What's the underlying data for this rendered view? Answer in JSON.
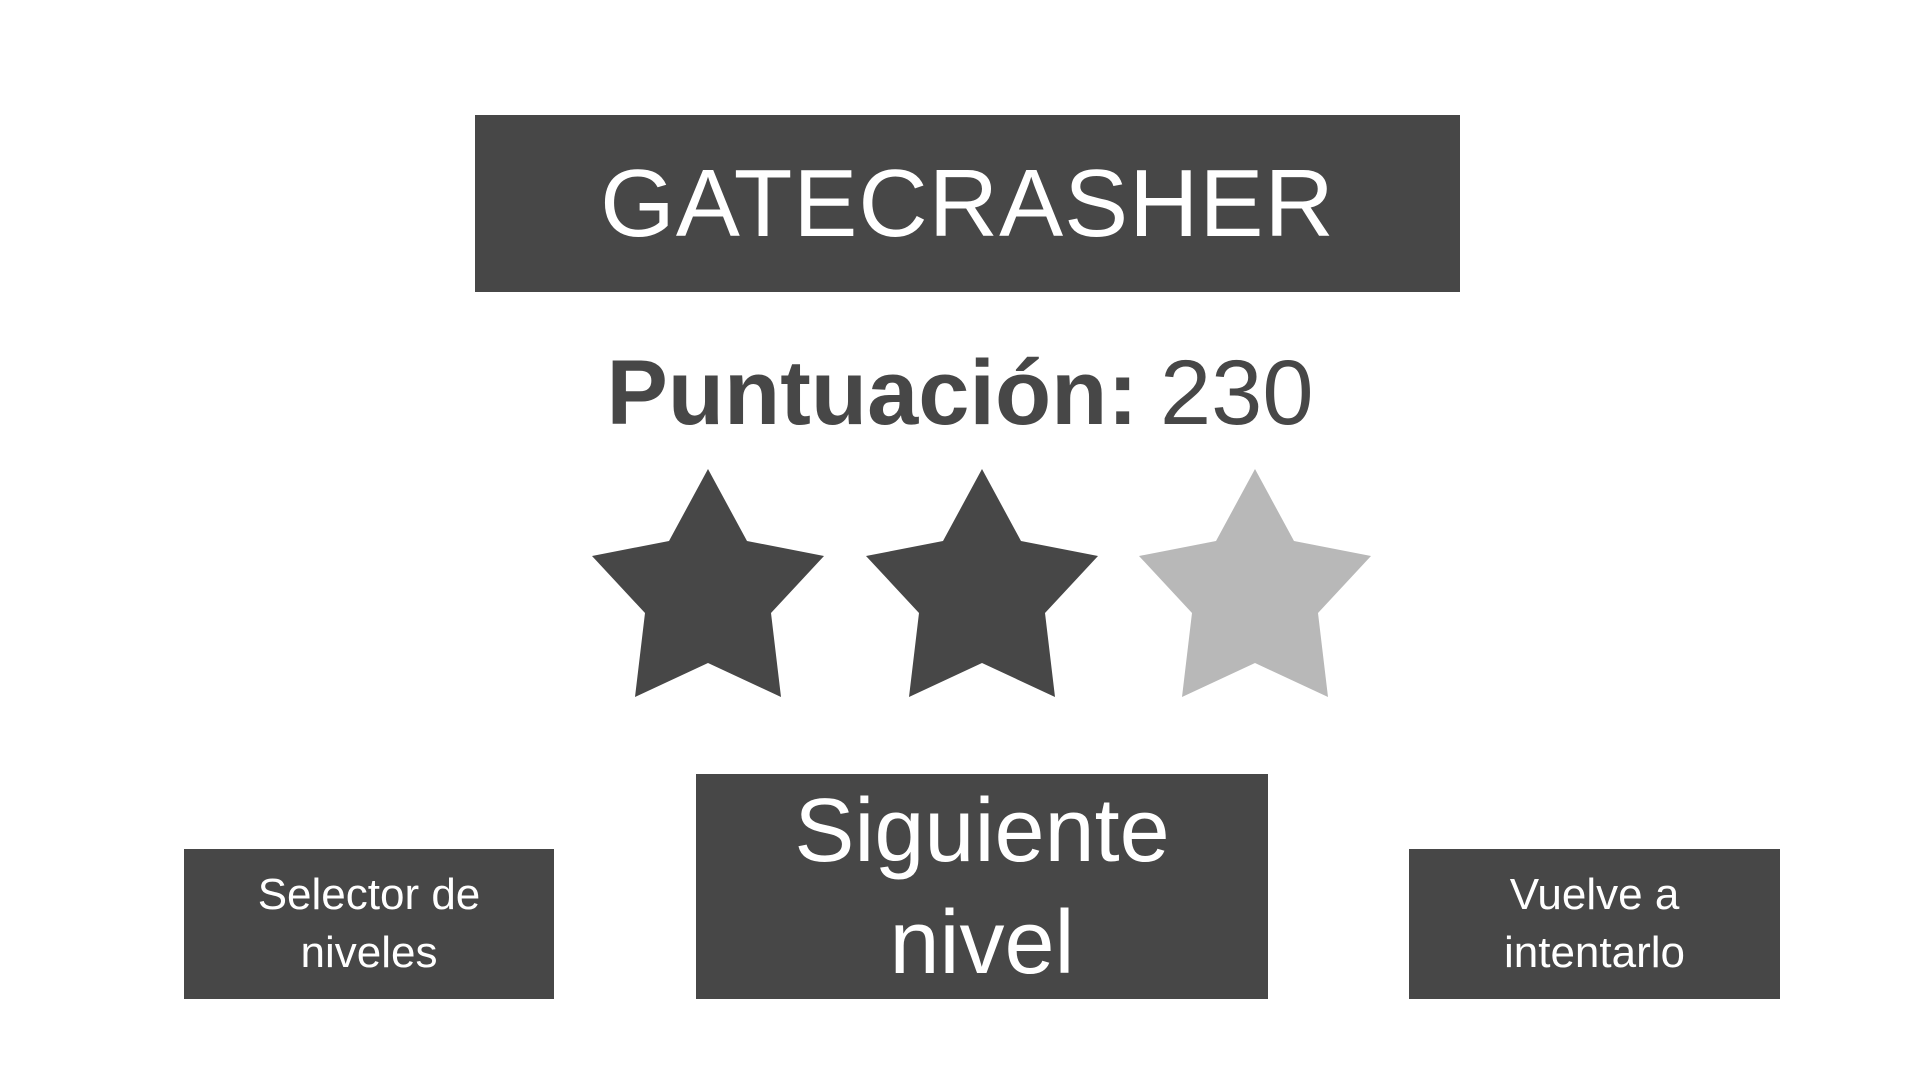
{
  "game": {
    "title": "GATECRASHER"
  },
  "score": {
    "label": "Puntuación:",
    "value": "230"
  },
  "rating": {
    "stars_earned": 2,
    "stars_total": 3,
    "filled_color": "#474747",
    "empty_color": "#b8b8b8"
  },
  "buttons": {
    "level_selector": "Selector de niveles",
    "next_level": "Siguiente nivel",
    "retry": "Vuelve a intentarlo"
  },
  "colors": {
    "panel": "#474747",
    "text_on_panel": "#ffffff",
    "background": "#ffffff"
  }
}
